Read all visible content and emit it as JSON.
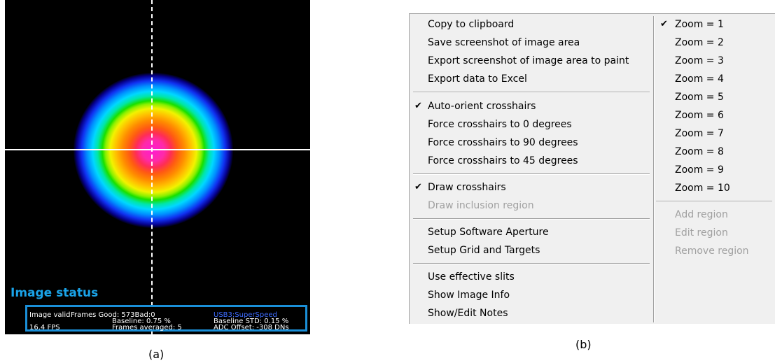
{
  "panel_a": {
    "image_status_title": "Image status",
    "status": {
      "image_valid": "Image valid",
      "frames_good": "Frames Good: 573Bad:0",
      "usb": "USB3:SuperSpeed",
      "baseline": "Baseline: 0.75 %",
      "baseline_std": "Baseline STD:  0.15 %",
      "fps": "16.4 FPS",
      "frames_averaged": "Frames averaged: 5",
      "adc_offset": "ADC Offset: -308 DNs"
    },
    "caption": "(a)"
  },
  "panel_b": {
    "caption": "(b)",
    "left_column": {
      "items": [
        {
          "label": "Copy to clipboard",
          "checked": false,
          "enabled": true
        },
        {
          "label": "Save screenshot of image area",
          "checked": false,
          "enabled": true
        },
        {
          "label": "Export screenshot of image area to paint",
          "checked": false,
          "enabled": true
        },
        {
          "label": "Export data to Excel",
          "checked": false,
          "enabled": true
        },
        {
          "label": "Auto-orient crosshairs",
          "checked": true,
          "enabled": true
        },
        {
          "label": "Force crosshairs to 0 degrees",
          "checked": false,
          "enabled": true
        },
        {
          "label": "Force crosshairs to 90 degrees",
          "checked": false,
          "enabled": true
        },
        {
          "label": "Force crosshairs to 45 degrees",
          "checked": false,
          "enabled": true
        },
        {
          "label": "Draw crosshairs",
          "checked": true,
          "enabled": true
        },
        {
          "label": "Draw inclusion region",
          "checked": false,
          "enabled": false
        },
        {
          "label": "Setup Software Aperture",
          "checked": false,
          "enabled": true
        },
        {
          "label": "Setup Grid and Targets",
          "checked": false,
          "enabled": true
        },
        {
          "label": "Use effective slits",
          "checked": false,
          "enabled": true
        },
        {
          "label": "Show Image Info",
          "checked": false,
          "enabled": true
        },
        {
          "label": "Show/Edit Notes",
          "checked": false,
          "enabled": true
        }
      ]
    },
    "right_column": {
      "zoom_items": [
        {
          "label": "Zoom = 1",
          "checked": true
        },
        {
          "label": "Zoom = 2",
          "checked": false
        },
        {
          "label": "Zoom = 3",
          "checked": false
        },
        {
          "label": "Zoom = 4",
          "checked": false
        },
        {
          "label": "Zoom = 5",
          "checked": false
        },
        {
          "label": "Zoom = 6",
          "checked": false
        },
        {
          "label": "Zoom = 7",
          "checked": false
        },
        {
          "label": "Zoom = 8",
          "checked": false
        },
        {
          "label": "Zoom = 9",
          "checked": false
        },
        {
          "label": "Zoom = 10",
          "checked": false
        }
      ],
      "region_items": [
        {
          "label": "Add region",
          "enabled": false
        },
        {
          "label": "Edit region",
          "enabled": false
        },
        {
          "label": "Remove region",
          "enabled": false
        }
      ]
    },
    "check_glyph": "✔"
  },
  "colors": {
    "status_accent": "#1aa3e8",
    "disabled_text": "#a0a0a0",
    "menu_background": "#f0f0f0"
  }
}
